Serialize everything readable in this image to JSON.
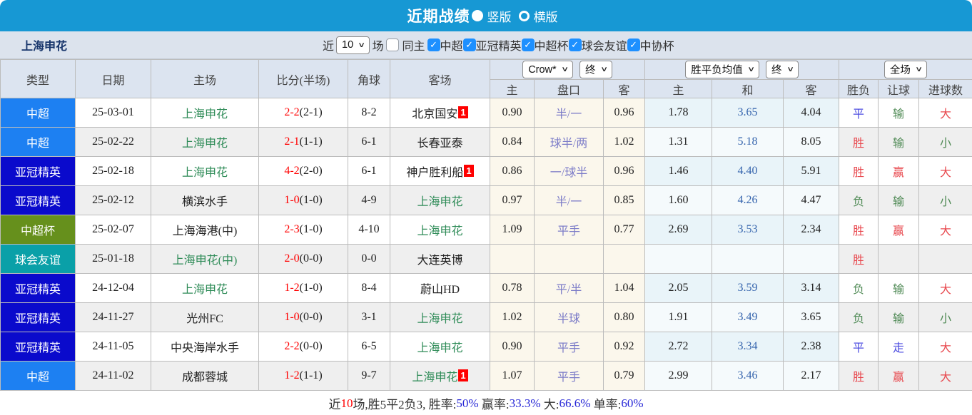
{
  "title_bar": {
    "title": "近期战绩",
    "view_options": [
      {
        "label": "竖版",
        "selected": true
      },
      {
        "label": "横版",
        "selected": false
      }
    ]
  },
  "filter_bar": {
    "team": "上海申花",
    "near_label": "近",
    "count_value": "10",
    "matches_label": "场",
    "same_home": {
      "label": "同主",
      "checked": false
    },
    "leagues": [
      {
        "label": "中超",
        "checked": true
      },
      {
        "label": "亚冠精英",
        "checked": true
      },
      {
        "label": "中超杯",
        "checked": true
      },
      {
        "label": "球会友谊",
        "checked": true
      },
      {
        "label": "中协杯",
        "checked": true
      }
    ]
  },
  "table": {
    "league_colors": {
      "中超": "#1d80f2",
      "亚冠精英": "#0a0acc",
      "中超杯": "#66901c",
      "球会友谊": "#0aa0a8"
    },
    "headers": {
      "type": "类型",
      "date": "日期",
      "home": "主场",
      "score": "比分(半场)",
      "corner": "角球",
      "away": "客场",
      "ah_home": "主",
      "ah_line": "盘口",
      "ah_away": "客",
      "eu_home": "主",
      "eu_draw": "和",
      "eu_away": "客",
      "res_wdl": "胜负",
      "res_handicap": "让球",
      "res_goals": "进球数"
    },
    "selects": {
      "ah_book": "Crow*",
      "ah_time": "终",
      "eu_type": "胜平负均值",
      "eu_time": "终",
      "scope": "全场"
    },
    "rows": [
      {
        "type": "中超",
        "date": "25-03-01",
        "home": "上海申花",
        "home_green": true,
        "score": "2-2",
        "half": "(2-1)",
        "corner": "8-2",
        "away": "北京国安",
        "away_green": false,
        "away_badge": "1",
        "ah_home": "0.90",
        "ah_line": "半/一",
        "ah_away": "0.96",
        "eu_home": "1.78",
        "eu_draw": "3.65",
        "eu_away": "4.04",
        "wdl": "平",
        "wdl_color": "blue",
        "handicap": "输",
        "handicap_color": "green",
        "goals": "大",
        "goals_color": "red"
      },
      {
        "type": "中超",
        "date": "25-02-22",
        "home": "上海申花",
        "home_green": true,
        "score": "2-1",
        "half": "(1-1)",
        "corner": "6-1",
        "away": "长春亚泰",
        "away_green": false,
        "away_badge": "",
        "ah_home": "0.84",
        "ah_line": "球半/两",
        "ah_away": "1.02",
        "eu_home": "1.31",
        "eu_draw": "5.18",
        "eu_away": "8.05",
        "wdl": "胜",
        "wdl_color": "red",
        "handicap": "输",
        "handicap_color": "green",
        "goals": "小",
        "goals_color": "green"
      },
      {
        "type": "亚冠精英",
        "date": "25-02-18",
        "home": "上海申花",
        "home_green": true,
        "score": "4-2",
        "half": "(2-0)",
        "corner": "6-1",
        "away": "神户胜利船",
        "away_green": false,
        "away_badge": "1",
        "ah_home": "0.86",
        "ah_line": "一/球半",
        "ah_away": "0.96",
        "eu_home": "1.46",
        "eu_draw": "4.40",
        "eu_away": "5.91",
        "wdl": "胜",
        "wdl_color": "red",
        "handicap": "赢",
        "handicap_color": "red",
        "goals": "大",
        "goals_color": "red"
      },
      {
        "type": "亚冠精英",
        "date": "25-02-12",
        "home": "横滨水手",
        "home_green": false,
        "score": "1-0",
        "half": "(1-0)",
        "corner": "4-9",
        "away": "上海申花",
        "away_green": true,
        "away_badge": "",
        "ah_home": "0.97",
        "ah_line": "半/一",
        "ah_away": "0.85",
        "eu_home": "1.60",
        "eu_draw": "4.26",
        "eu_away": "4.47",
        "wdl": "负",
        "wdl_color": "green",
        "handicap": "输",
        "handicap_color": "green",
        "goals": "小",
        "goals_color": "green"
      },
      {
        "type": "中超杯",
        "date": "25-02-07",
        "home": "上海海港(中)",
        "home_green": false,
        "score": "2-3",
        "half": "(1-0)",
        "corner": "4-10",
        "away": "上海申花",
        "away_green": true,
        "away_badge": "",
        "ah_home": "1.09",
        "ah_line": "平手",
        "ah_away": "0.77",
        "eu_home": "2.69",
        "eu_draw": "3.53",
        "eu_away": "2.34",
        "wdl": "胜",
        "wdl_color": "red",
        "handicap": "赢",
        "handicap_color": "red",
        "goals": "大",
        "goals_color": "red"
      },
      {
        "type": "球会友谊",
        "date": "25-01-18",
        "home": "上海申花(中)",
        "home_green": true,
        "score": "2-0",
        "half": "(0-0)",
        "corner": "0-0",
        "away": "大连英博",
        "away_green": false,
        "away_badge": "",
        "ah_home": "",
        "ah_line": "",
        "ah_away": "",
        "eu_home": "",
        "eu_draw": "",
        "eu_away": "",
        "wdl": "胜",
        "wdl_color": "red",
        "handicap": "",
        "handicap_color": "",
        "goals": "",
        "goals_color": ""
      },
      {
        "type": "亚冠精英",
        "date": "24-12-04",
        "home": "上海申花",
        "home_green": true,
        "score": "1-2",
        "half": "(1-0)",
        "corner": "8-4",
        "away": "蔚山HD",
        "away_green": false,
        "away_badge": "",
        "ah_home": "0.78",
        "ah_line": "平/半",
        "ah_away": "1.04",
        "eu_home": "2.05",
        "eu_draw": "3.59",
        "eu_away": "3.14",
        "wdl": "负",
        "wdl_color": "green",
        "handicap": "输",
        "handicap_color": "green",
        "goals": "大",
        "goals_color": "red"
      },
      {
        "type": "亚冠精英",
        "date": "24-11-27",
        "home": "光州FC",
        "home_green": false,
        "score": "1-0",
        "half": "(0-0)",
        "corner": "3-1",
        "away": "上海申花",
        "away_green": true,
        "away_badge": "",
        "ah_home": "1.02",
        "ah_line": "半球",
        "ah_away": "0.80",
        "eu_home": "1.91",
        "eu_draw": "3.49",
        "eu_away": "3.65",
        "wdl": "负",
        "wdl_color": "green",
        "handicap": "输",
        "handicap_color": "green",
        "goals": "小",
        "goals_color": "green"
      },
      {
        "type": "亚冠精英",
        "date": "24-11-05",
        "home": "中央海岸水手",
        "home_green": false,
        "score": "2-2",
        "half": "(0-0)",
        "corner": "6-5",
        "away": "上海申花",
        "away_green": true,
        "away_badge": "",
        "ah_home": "0.90",
        "ah_line": "平手",
        "ah_away": "0.92",
        "eu_home": "2.72",
        "eu_draw": "3.34",
        "eu_away": "2.38",
        "wdl": "平",
        "wdl_color": "blue",
        "handicap": "走",
        "handicap_color": "blue",
        "goals": "大",
        "goals_color": "red"
      },
      {
        "type": "中超",
        "date": "24-11-02",
        "home": "成都蓉城",
        "home_green": false,
        "score": "1-2",
        "half": "(1-1)",
        "corner": "9-7",
        "away": "上海申花",
        "away_green": true,
        "away_badge": "1",
        "ah_home": "1.07",
        "ah_line": "平手",
        "ah_away": "0.79",
        "eu_home": "2.99",
        "eu_draw": "3.46",
        "eu_away": "2.17",
        "wdl": "胜",
        "wdl_color": "red",
        "handicap": "赢",
        "handicap_color": "red",
        "goals": "大",
        "goals_color": "red"
      }
    ]
  },
  "summary": {
    "segments": [
      {
        "text": "近",
        "color": "dark"
      },
      {
        "text": "10",
        "color": "red"
      },
      {
        "text": "场,胜5平2负3, 胜率:",
        "color": "dark"
      },
      {
        "text": "50%",
        "color": "blue"
      },
      {
        "text": " 赢率:",
        "color": "dark"
      },
      {
        "text": "33.3%",
        "color": "blue"
      },
      {
        "text": " 大:",
        "color": "dark"
      },
      {
        "text": "66.6%",
        "color": "blue"
      },
      {
        "text": " 单率:",
        "color": "dark"
      },
      {
        "text": "60%",
        "color": "blue"
      }
    ]
  }
}
